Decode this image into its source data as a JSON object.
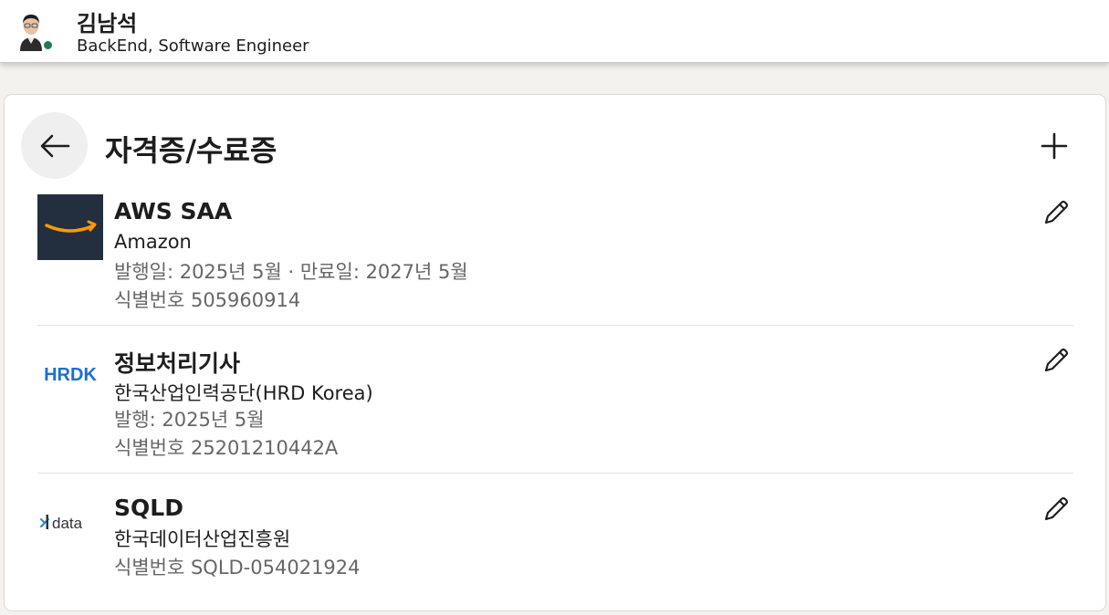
{
  "profile": {
    "name": "김남석",
    "headline": "BackEnd, Software Engineer",
    "presence_color": "#1e7c4f"
  },
  "section": {
    "title": "자격증/수료증",
    "back_icon": "arrow-left-icon",
    "add_icon": "plus-icon"
  },
  "certifications": [
    {
      "name": "AWS SAA",
      "issuer": "Amazon",
      "dates": "발행일: 2025년 5월 · 만료일: 2027년 5월",
      "credential_id": "식별번호 505960914",
      "logo": "amazon-logo",
      "edit_icon": "pencil-icon"
    },
    {
      "name": "정보처리기사",
      "issuer": "한국산업인력공단(HRD Korea)",
      "dates": "발행: 2025년 5월",
      "credential_id": "식별번호 25201210442A",
      "logo": "hrdk-logo",
      "logo_text": "HRDK",
      "edit_icon": "pencil-icon"
    },
    {
      "name": "SQLD",
      "issuer": "한국데이터산업진흥원",
      "credential_id": "식별번호 SQLD-054021924",
      "logo": "kdata-logo",
      "logo_text": "data",
      "edit_icon": "pencil-icon"
    }
  ],
  "colors": {
    "amazon_bg": "#232f3e",
    "amazon_smile": "#ff9900",
    "hrdk_blue": "#1b6fd1",
    "kdata_blue": "#1f8ad6",
    "meta_text": "#666666"
  }
}
